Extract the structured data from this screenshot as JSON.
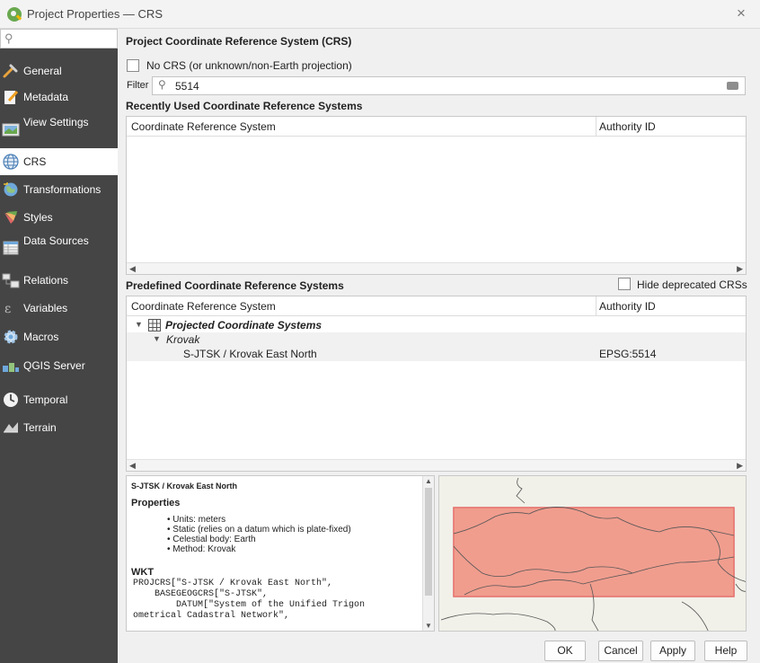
{
  "window": {
    "title": "Project Properties — CRS",
    "close_glyph": "×"
  },
  "sidebar": {
    "search_placeholder": "",
    "items": [
      {
        "label": "General",
        "icon": "wrench-icon"
      },
      {
        "label": "Metadata",
        "icon": "pencil-document-icon"
      },
      {
        "label": "View Settings",
        "icon": "view-settings-icon"
      },
      {
        "label": "CRS",
        "icon": "globe-icon"
      },
      {
        "label": "Transformations",
        "icon": "transformations-globe-icon"
      },
      {
        "label": "Styles",
        "icon": "paint-brush-icon"
      },
      {
        "label": "Data Sources",
        "icon": "table-icon"
      },
      {
        "label": "Relations",
        "icon": "relations-icon"
      },
      {
        "label": "Variables",
        "icon": "variables-icon"
      },
      {
        "label": "Macros",
        "icon": "macros-icon"
      },
      {
        "label": "QGIS Server",
        "icon": "server-icon"
      },
      {
        "label": "Temporal",
        "icon": "clock-icon"
      },
      {
        "label": "Terrain",
        "icon": "terrain-icon"
      }
    ],
    "active": "CRS"
  },
  "main": {
    "header": "Project Coordinate Reference System (CRS)",
    "no_crs_label": "No CRS (or unknown/non-Earth projection)",
    "filter_label": "Filter",
    "filter_value": "5514",
    "recent": {
      "title": "Recently Used Coordinate Reference Systems",
      "col_crs": "Coordinate Reference System",
      "col_auth": "Authority ID"
    },
    "predefined": {
      "title": "Predefined Coordinate Reference Systems",
      "hide_deprecated": "Hide deprecated CRSs",
      "col_crs": "Coordinate Reference System",
      "col_auth": "Authority ID",
      "rows": [
        {
          "label": "Projected Coordinate Systems",
          "auth": ""
        },
        {
          "label": "Krovak",
          "auth": ""
        },
        {
          "label": "S-JTSK / Krovak East North",
          "auth": "EPSG:5514"
        }
      ]
    },
    "info": {
      "title": "S-JTSK / Krovak East North",
      "properties_title": "Properties",
      "bullets": [
        "Units: meters",
        "Static (relies on a datum which is plate-fixed)",
        "Celestial body: Earth",
        "Method: Krovak"
      ],
      "wkt_title": "WKT",
      "wkt_lines": [
        "PROJCRS[\"S-JTSK / Krovak East North\",",
        "    BASEGEOGCRS[\"S-JTSK\",",
        "        DATUM[\"System of the Unified Trigon",
        "ometrical Cadastral Network\","
      ]
    },
    "extent_color": "#f08070"
  },
  "buttons": {
    "ok": "OK",
    "cancel": "Cancel",
    "apply": "Apply",
    "help": "Help"
  }
}
